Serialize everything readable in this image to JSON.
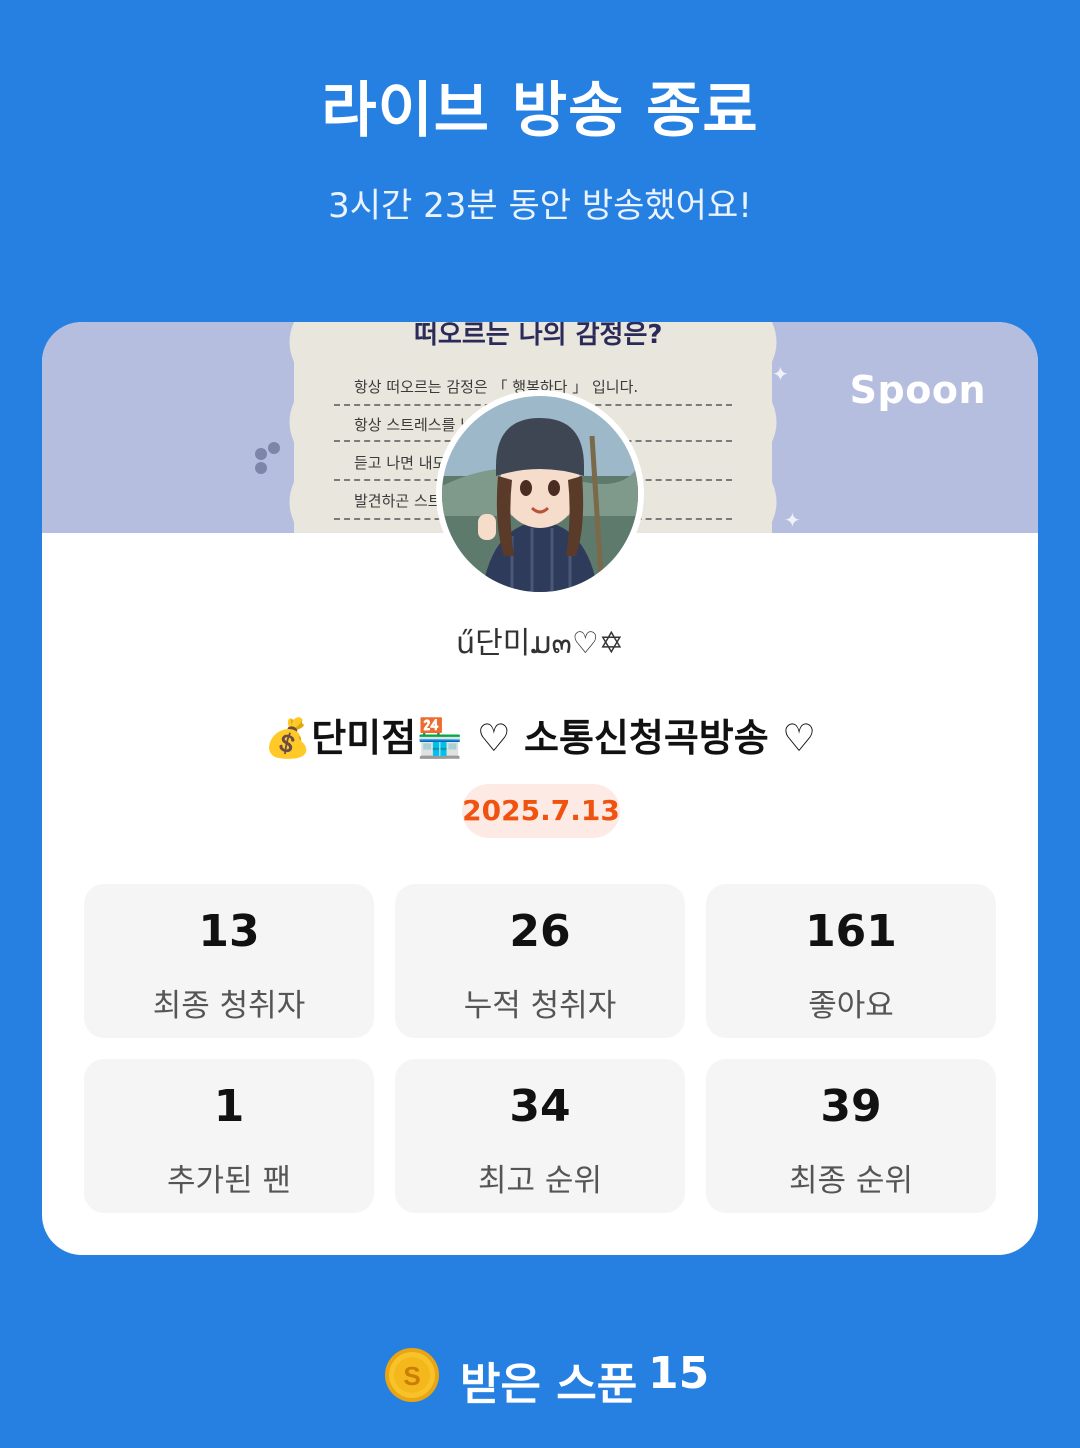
{
  "header": {
    "title": "라이브 방송 종료",
    "subtitle": "3시간 23분 동안 방송했어요!"
  },
  "card": {
    "brand": "Spoon",
    "nickname": "ű단미ມ๓♡✡",
    "live_title": "💰단미점🏪 ♡ 소통신청곡방송 ♡",
    "date": "2025.7.13",
    "stats": [
      {
        "value": "13",
        "label": "최종 청취자"
      },
      {
        "value": "26",
        "label": "누적 청취자"
      },
      {
        "value": "161",
        "label": "좋아요"
      },
      {
        "value": "1",
        "label": "추가된 팬"
      },
      {
        "value": "34",
        "label": "최고 순위"
      },
      {
        "value": "39",
        "label": "최종 순위"
      }
    ],
    "banner_note": {
      "heading": "떠오르는 나의 감정은?",
      "lines": [
        "항상 떠오르는 감정은 「 행복하다 」 입니다.",
        "항상 스트레스를            님의 방송을",
        "듣고 나면                      내모습을",
        "발견하곤                      스트레스는"
      ]
    }
  },
  "footer": {
    "spoon_label": "받은 스푼",
    "spoon_count": "15"
  },
  "colors": {
    "background": "#2680E2",
    "banner": "#B5BEDE",
    "date_text": "#F0520F",
    "date_bg": "#FDEAE4",
    "coin": "#F5B81C"
  },
  "icons": {
    "coin": "spoon-coin-icon",
    "avatar": "profile-avatar"
  }
}
